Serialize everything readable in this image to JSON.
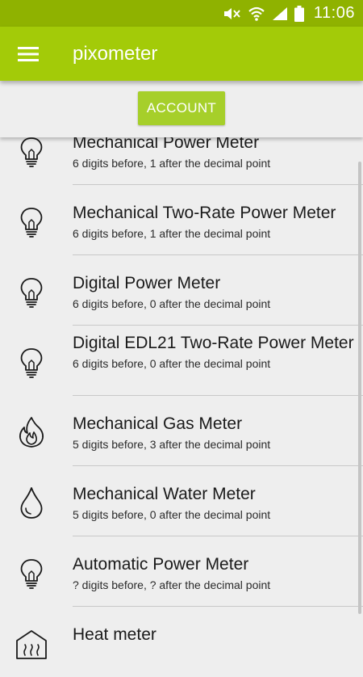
{
  "status_bar": {
    "time": "11:06",
    "icons": [
      "mute-icon",
      "wifi-icon",
      "signal-icon",
      "battery-icon"
    ]
  },
  "app_bar": {
    "title": "pixometer",
    "menu_icon": "hamburger-menu-icon"
  },
  "account": {
    "button_label": "ACCOUNT"
  },
  "meters": [
    {
      "name": "Mechanical Power Meter",
      "desc": "6 digits before, 1 after the decimal point",
      "icon": "bulb-icon"
    },
    {
      "name": "Mechanical Two-Rate Power Meter",
      "desc": "6 digits before, 1 after the decimal point",
      "icon": "bulb-icon"
    },
    {
      "name": "Digital Power Meter",
      "desc": "6 digits before, 0 after the decimal point",
      "icon": "bulb-icon"
    },
    {
      "name": "Digital EDL21 Two-Rate Power Meter",
      "desc": "6 digits before, 0 after the decimal point",
      "icon": "bulb-icon"
    },
    {
      "name": "Mechanical Gas Meter",
      "desc": "5 digits before, 3 after the decimal point",
      "icon": "flame-icon"
    },
    {
      "name": "Mechanical Water Meter",
      "desc": "5 digits before, 0 after the decimal point",
      "icon": "water-drop-icon"
    },
    {
      "name": "Automatic Power Meter",
      "desc": "? digits before, ? after the decimal point",
      "icon": "bulb-icon"
    },
    {
      "name": "Heat meter",
      "desc": "",
      "icon": "heat-icon"
    }
  ],
  "colors": {
    "status_bar": "#8fb200",
    "app_bar": "#a3cb08",
    "account_button": "#a6cf2a",
    "background": "#eeeeee"
  }
}
